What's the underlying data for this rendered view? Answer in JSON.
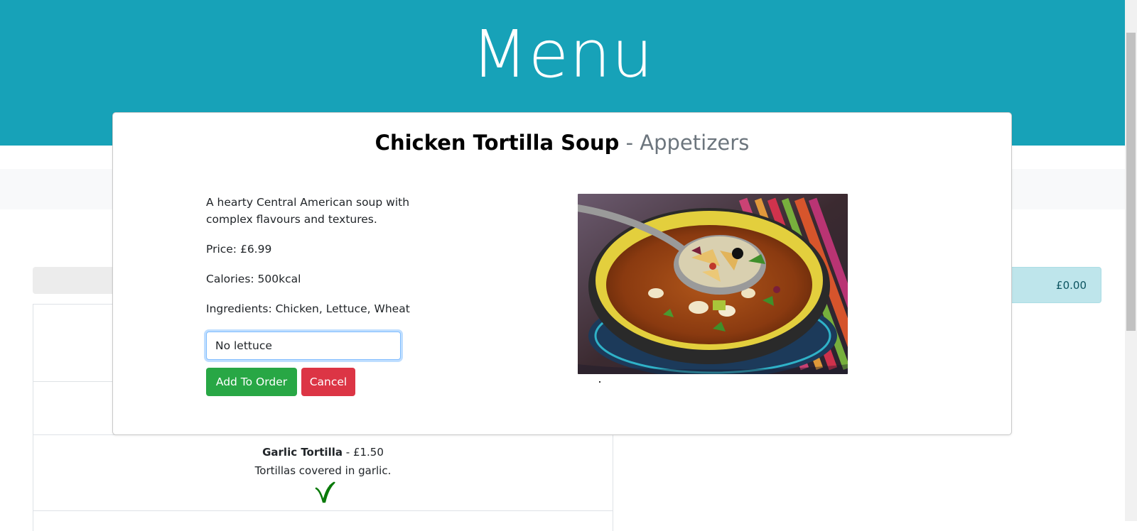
{
  "header": {
    "title": "Menu"
  },
  "order": {
    "total": "£0.00"
  },
  "menu_items": [
    {
      "name": "Garlic Tortilla",
      "separator": " - ",
      "price": "£1.50",
      "description": "Tortillas covered in garlic.",
      "badge_icon": "vegan-v-icon"
    }
  ],
  "modal": {
    "item_name": "Chicken Tortilla Soup",
    "separator": " - ",
    "category": "Appetizers",
    "description": "A hearty Central American soup with complex flavours and textures.",
    "price": "Price: £6.99",
    "calories": "Calories: 500kcal",
    "ingredients": "Ingredients: Chicken, Lettuce, Wheat",
    "notes_value": "No lettuce",
    "add_label": "Add To Order",
    "cancel_label": "Cancel",
    "image_icon": "soup-photo"
  },
  "colors": {
    "hero": "#17a2b8",
    "add_button": "#28a745",
    "cancel_button": "#dc3545",
    "total_bar": "#bee5eb",
    "vegan_icon": "#0a7a0a"
  }
}
